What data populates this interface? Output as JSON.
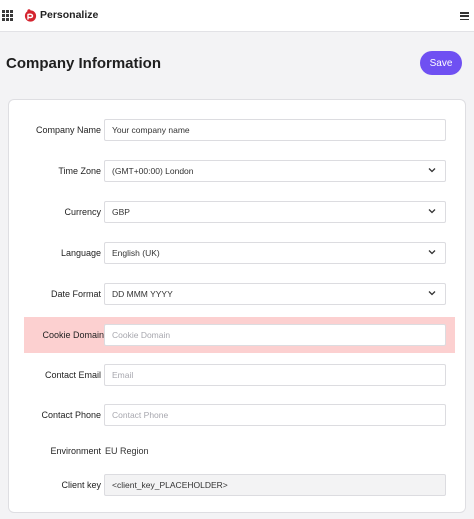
{
  "app": {
    "title": "Personalize",
    "brand_color": "#d4242f"
  },
  "header": {
    "grid_icon": "apps-grid-icon",
    "menu_icon": "hamburger-menu-icon"
  },
  "page": {
    "title": "Company Information",
    "save_label": "Save",
    "accent": "#6f50f2"
  },
  "form": {
    "company_name": {
      "label": "Company Name",
      "value": "Your company name"
    },
    "time_zone": {
      "label": "Time Zone",
      "value": "(GMT+00:00) London"
    },
    "currency": {
      "label": "Currency",
      "value": "GBP"
    },
    "language": {
      "label": "Language",
      "value": "English (UK)"
    },
    "date_format": {
      "label": "Date Format",
      "value": "DD MMM YYYY"
    },
    "cookie_domain": {
      "label": "Cookie Domain",
      "placeholder": "Cookie Domain",
      "highlight_color": "#fcd0d0"
    },
    "contact_email": {
      "label": "Contact Email",
      "placeholder": "Email"
    },
    "contact_phone": {
      "label": "Contact Phone",
      "placeholder": "Contact Phone"
    },
    "environment": {
      "label": "Environment",
      "value": "EU Region"
    },
    "client_key": {
      "label": "Client key",
      "value": "<client_key_PLACEHOLDER>"
    }
  }
}
